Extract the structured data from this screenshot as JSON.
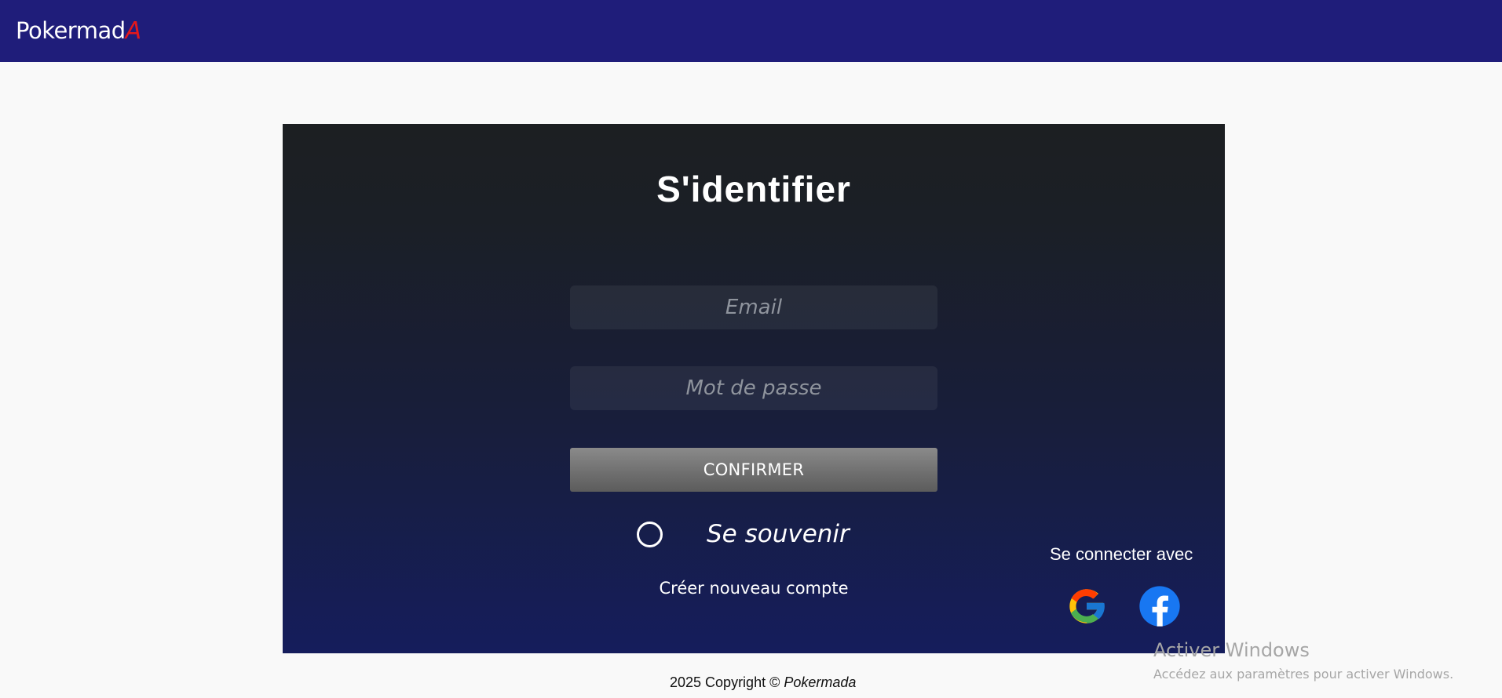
{
  "header": {
    "brand_text": "Pokermad",
    "brand_accent": "A",
    "background_color": "#1f1d7a",
    "accent_color": "#e3171b"
  },
  "login": {
    "title": "S'identifier",
    "email_placeholder": "Email",
    "password_placeholder": "Mot de passe",
    "confirm_label": "CONFIRMER",
    "remember_label": "Se souvenir",
    "create_account_label": "Créer nouveau compte"
  },
  "social": {
    "title": "Se connecter avec",
    "providers": [
      {
        "name": "google",
        "icon": "google-icon"
      },
      {
        "name": "facebook",
        "icon": "facebook-icon"
      }
    ]
  },
  "footer": {
    "copyright": "2025 Copyright ©",
    "brand": "Pokermada"
  },
  "os_watermark": {
    "title": "Activer Windows",
    "subtitle": "Accédez aux paramètres pour activer Windows."
  }
}
